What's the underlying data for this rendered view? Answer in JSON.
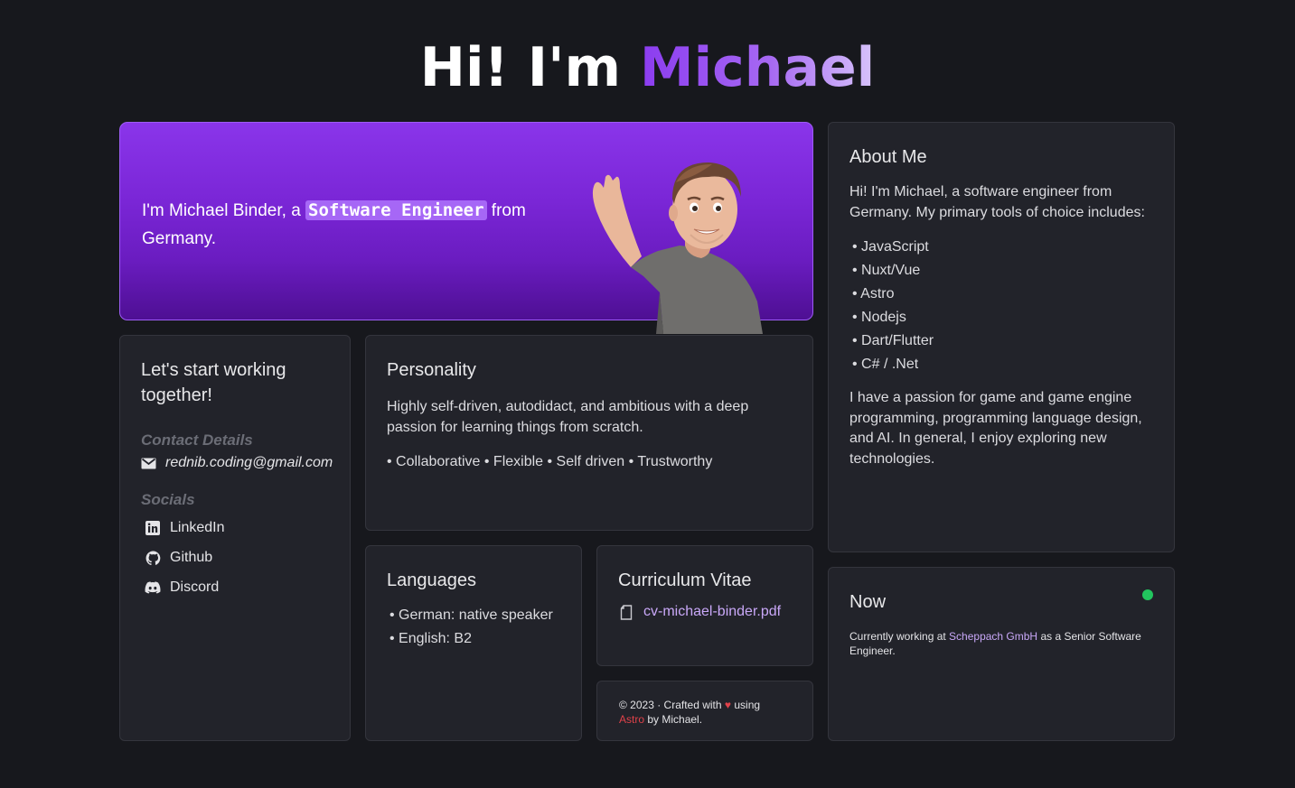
{
  "header": {
    "title_prefix": "Hi! I'm ",
    "title_name": "Michael"
  },
  "hero": {
    "text_before": "I'm Michael Binder, a ",
    "role": "Software Engineer",
    "text_after": " from Germany."
  },
  "contact": {
    "title": "Let's start working together!",
    "details_heading": "Contact Details",
    "email": "rednib.coding@gmail.com",
    "socials_heading": "Socials",
    "socials": [
      {
        "label": "LinkedIn",
        "icon": "linkedin-icon"
      },
      {
        "label": "Github",
        "icon": "github-icon"
      },
      {
        "label": "Discord",
        "icon": "discord-icon"
      }
    ]
  },
  "personality": {
    "title": "Personality",
    "text": "Highly self-driven, autodidact, and ambitious with a deep passion for learning things from scratch.",
    "traits": "• Collaborative • Flexible • Self driven • Trustworthy"
  },
  "languages": {
    "title": "Languages",
    "items": [
      "• German: native speaker",
      "• English: B2"
    ]
  },
  "cv": {
    "title": "Curriculum Vitae",
    "file": "cv-michael-binder.pdf",
    "icon": "file-icon"
  },
  "footer": {
    "prefix": "© 2023 · Crafted with ",
    "heart": "♥",
    "using": " using",
    "astro": "Astro",
    "suffix": " by Michael."
  },
  "about": {
    "title": "About Me",
    "intro": "Hi! I'm Michael, a software engineer from Germany. My primary tools of choice includes:",
    "tools": [
      "• JavaScript",
      "• Nuxt/Vue",
      "• Astro",
      "• Nodejs",
      "• Dart/Flutter",
      "• C# / .Net"
    ],
    "outro": "I have a passion for game and game engine programming, programming language design, and AI. In general, I enjoy exploring new technologies."
  },
  "now": {
    "title": "Now",
    "prefix": "Currently working at ",
    "company": "Scheppach GmbH",
    "suffix": " as a Senior Software Engineer.",
    "status_color": "#22c55e"
  },
  "colors": {
    "accent": "#8b3cf0",
    "background": "#17181d",
    "card": "#22232a"
  }
}
